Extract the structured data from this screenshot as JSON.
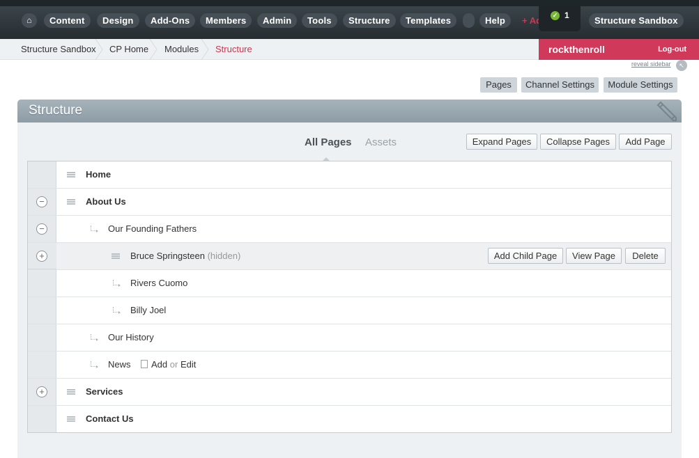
{
  "nav": {
    "home_icon": "home-icon",
    "items": [
      "Content",
      "Design",
      "Add-Ons",
      "Members",
      "Admin",
      "Tools",
      "Structure",
      "Templates",
      "Help"
    ],
    "add_label": "+ Add",
    "notification_count": "1",
    "site_name": "Structure Sandbox"
  },
  "breadcrumb": [
    "Structure Sandbox",
    "CP Home",
    "Modules",
    "Structure"
  ],
  "user": {
    "name": "rockthenroll",
    "logout": "Log-out"
  },
  "sidebar_link": "reveal sidebar",
  "module_buttons": [
    "Pages",
    "Channel Settings",
    "Module Settings"
  ],
  "panel": {
    "title": "Structure",
    "tabs": [
      "All Pages",
      "Assets"
    ],
    "actions": [
      "Expand Pages",
      "Collapse Pages",
      "Add Page"
    ]
  },
  "tree": [
    {
      "label": "Home",
      "level": 0,
      "toggle": ""
    },
    {
      "label": "About Us",
      "level": 0,
      "toggle": "minus"
    },
    {
      "label": "Our Founding Fathers",
      "level": 1,
      "toggle": "minus"
    },
    {
      "label": "Bruce Springsteen",
      "note": "(hidden)",
      "level": 2,
      "toggle": "plus"
    },
    {
      "label": "Rivers Cuomo",
      "level": 2,
      "toggle": ""
    },
    {
      "label": "Billy Joel",
      "level": 2,
      "toggle": ""
    },
    {
      "label": "Our History",
      "level": 1,
      "toggle": ""
    },
    {
      "label": "News",
      "level": 1,
      "toggle": "",
      "add": "Add",
      "or": "or",
      "edit": "Edit"
    },
    {
      "label": "Services",
      "level": 0,
      "toggle": "plus"
    },
    {
      "label": "Contact Us",
      "level": 0,
      "toggle": ""
    }
  ],
  "row_actions": [
    "Add Child Page",
    "View Page",
    "Delete"
  ]
}
